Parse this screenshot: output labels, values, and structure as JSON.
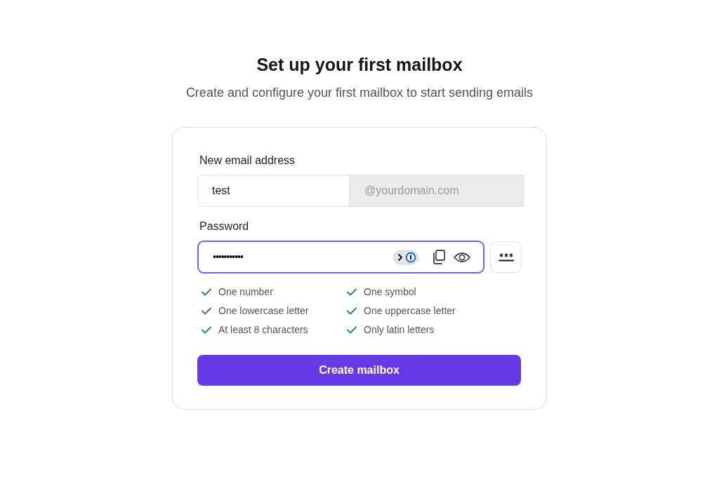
{
  "heading": {
    "title": "Set up your first mailbox",
    "subtitle": "Create and configure your first mailbox to start sending emails"
  },
  "email": {
    "label": "New email address",
    "value": "test",
    "domain": "@yourdomain.com"
  },
  "password": {
    "label": "Password",
    "value": "•••••••••••",
    "focused": true
  },
  "requirements": [
    {
      "label": "One number",
      "met": true
    },
    {
      "label": "One symbol",
      "met": true
    },
    {
      "label": "One lowercase letter",
      "met": true
    },
    {
      "label": "One uppercase letter",
      "met": true
    },
    {
      "label": "At least 8 characters",
      "met": true
    },
    {
      "label": "Only latin letters",
      "met": true
    }
  ],
  "submit": {
    "label": "Create mailbox"
  }
}
